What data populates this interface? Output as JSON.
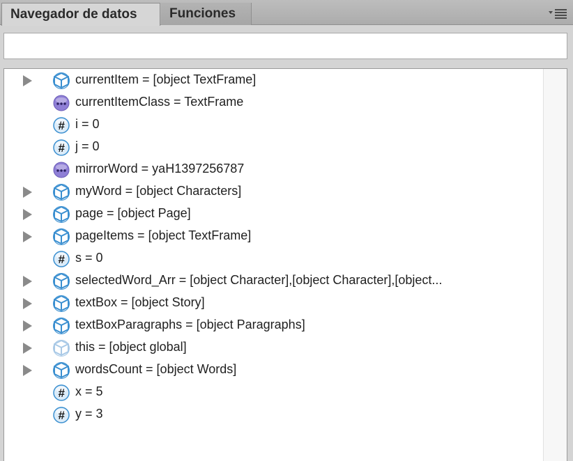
{
  "tabs": [
    {
      "label": "Navegador de datos",
      "active": true
    },
    {
      "label": "Funciones",
      "active": false
    }
  ],
  "search": {
    "value": "",
    "placeholder": ""
  },
  "colors": {
    "object_icon": "#3a8fd0",
    "object_icon_faded": "#a9c9e6",
    "string_icon": "#8f7fd6",
    "number_icon": "#3a8fd0",
    "expand_arrow": "#8a8a8a"
  },
  "rows": [
    {
      "label": "currentItem = [object TextFrame]",
      "icon": "cube-icon",
      "expandable": true
    },
    {
      "label": "currentItemClass = TextFrame",
      "icon": "string-icon",
      "expandable": false
    },
    {
      "label": "i = 0",
      "icon": "number-icon",
      "expandable": false
    },
    {
      "label": "j = 0",
      "icon": "number-icon",
      "expandable": false
    },
    {
      "label": "mirrorWord = yaH1397256787",
      "icon": "string-icon",
      "expandable": false
    },
    {
      "label": "myWord = [object Characters]",
      "icon": "cube-icon",
      "expandable": true
    },
    {
      "label": "page = [object Page]",
      "icon": "cube-icon",
      "expandable": true
    },
    {
      "label": "pageItems = [object TextFrame]",
      "icon": "cube-icon",
      "expandable": true
    },
    {
      "label": "s = 0",
      "icon": "number-icon",
      "expandable": false
    },
    {
      "label": "selectedWord_Arr = [object Character],[object Character],[object...",
      "icon": "cube-icon",
      "expandable": true
    },
    {
      "label": "textBox = [object Story]",
      "icon": "cube-icon",
      "expandable": true
    },
    {
      "label": "textBoxParagraphs = [object Paragraphs]",
      "icon": "cube-icon",
      "expandable": true
    },
    {
      "label": "this = [object global]",
      "icon": "cube-faded-icon",
      "expandable": true
    },
    {
      "label": "wordsCount = [object Words]",
      "icon": "cube-icon",
      "expandable": true
    },
    {
      "label": "x = 5",
      "icon": "number-icon",
      "expandable": false
    },
    {
      "label": "y = 3",
      "icon": "number-icon",
      "expandable": false
    }
  ]
}
